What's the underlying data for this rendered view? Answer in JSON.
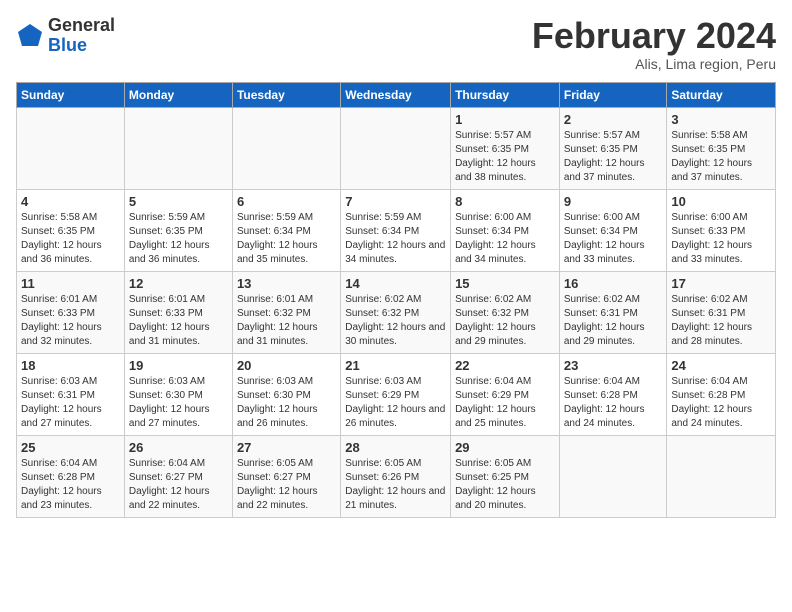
{
  "header": {
    "logo_general": "General",
    "logo_blue": "Blue",
    "title": "February 2024",
    "subtitle": "Alis, Lima region, Peru"
  },
  "columns": [
    "Sunday",
    "Monday",
    "Tuesday",
    "Wednesday",
    "Thursday",
    "Friday",
    "Saturday"
  ],
  "weeks": [
    [
      {
        "day": "",
        "detail": ""
      },
      {
        "day": "",
        "detail": ""
      },
      {
        "day": "",
        "detail": ""
      },
      {
        "day": "",
        "detail": ""
      },
      {
        "day": "1",
        "detail": "Sunrise: 5:57 AM\nSunset: 6:35 PM\nDaylight: 12 hours\nand 38 minutes."
      },
      {
        "day": "2",
        "detail": "Sunrise: 5:57 AM\nSunset: 6:35 PM\nDaylight: 12 hours\nand 37 minutes."
      },
      {
        "day": "3",
        "detail": "Sunrise: 5:58 AM\nSunset: 6:35 PM\nDaylight: 12 hours\nand 37 minutes."
      }
    ],
    [
      {
        "day": "4",
        "detail": "Sunrise: 5:58 AM\nSunset: 6:35 PM\nDaylight: 12 hours\nand 36 minutes."
      },
      {
        "day": "5",
        "detail": "Sunrise: 5:59 AM\nSunset: 6:35 PM\nDaylight: 12 hours\nand 36 minutes."
      },
      {
        "day": "6",
        "detail": "Sunrise: 5:59 AM\nSunset: 6:34 PM\nDaylight: 12 hours\nand 35 minutes."
      },
      {
        "day": "7",
        "detail": "Sunrise: 5:59 AM\nSunset: 6:34 PM\nDaylight: 12 hours\nand 34 minutes."
      },
      {
        "day": "8",
        "detail": "Sunrise: 6:00 AM\nSunset: 6:34 PM\nDaylight: 12 hours\nand 34 minutes."
      },
      {
        "day": "9",
        "detail": "Sunrise: 6:00 AM\nSunset: 6:34 PM\nDaylight: 12 hours\nand 33 minutes."
      },
      {
        "day": "10",
        "detail": "Sunrise: 6:00 AM\nSunset: 6:33 PM\nDaylight: 12 hours\nand 33 minutes."
      }
    ],
    [
      {
        "day": "11",
        "detail": "Sunrise: 6:01 AM\nSunset: 6:33 PM\nDaylight: 12 hours\nand 32 minutes."
      },
      {
        "day": "12",
        "detail": "Sunrise: 6:01 AM\nSunset: 6:33 PM\nDaylight: 12 hours\nand 31 minutes."
      },
      {
        "day": "13",
        "detail": "Sunrise: 6:01 AM\nSunset: 6:32 PM\nDaylight: 12 hours\nand 31 minutes."
      },
      {
        "day": "14",
        "detail": "Sunrise: 6:02 AM\nSunset: 6:32 PM\nDaylight: 12 hours\nand 30 minutes."
      },
      {
        "day": "15",
        "detail": "Sunrise: 6:02 AM\nSunset: 6:32 PM\nDaylight: 12 hours\nand 29 minutes."
      },
      {
        "day": "16",
        "detail": "Sunrise: 6:02 AM\nSunset: 6:31 PM\nDaylight: 12 hours\nand 29 minutes."
      },
      {
        "day": "17",
        "detail": "Sunrise: 6:02 AM\nSunset: 6:31 PM\nDaylight: 12 hours\nand 28 minutes."
      }
    ],
    [
      {
        "day": "18",
        "detail": "Sunrise: 6:03 AM\nSunset: 6:31 PM\nDaylight: 12 hours\nand 27 minutes."
      },
      {
        "day": "19",
        "detail": "Sunrise: 6:03 AM\nSunset: 6:30 PM\nDaylight: 12 hours\nand 27 minutes."
      },
      {
        "day": "20",
        "detail": "Sunrise: 6:03 AM\nSunset: 6:30 PM\nDaylight: 12 hours\nand 26 minutes."
      },
      {
        "day": "21",
        "detail": "Sunrise: 6:03 AM\nSunset: 6:29 PM\nDaylight: 12 hours\nand 26 minutes."
      },
      {
        "day": "22",
        "detail": "Sunrise: 6:04 AM\nSunset: 6:29 PM\nDaylight: 12 hours\nand 25 minutes."
      },
      {
        "day": "23",
        "detail": "Sunrise: 6:04 AM\nSunset: 6:28 PM\nDaylight: 12 hours\nand 24 minutes."
      },
      {
        "day": "24",
        "detail": "Sunrise: 6:04 AM\nSunset: 6:28 PM\nDaylight: 12 hours\nand 24 minutes."
      }
    ],
    [
      {
        "day": "25",
        "detail": "Sunrise: 6:04 AM\nSunset: 6:28 PM\nDaylight: 12 hours\nand 23 minutes."
      },
      {
        "day": "26",
        "detail": "Sunrise: 6:04 AM\nSunset: 6:27 PM\nDaylight: 12 hours\nand 22 minutes."
      },
      {
        "day": "27",
        "detail": "Sunrise: 6:05 AM\nSunset: 6:27 PM\nDaylight: 12 hours\nand 22 minutes."
      },
      {
        "day": "28",
        "detail": "Sunrise: 6:05 AM\nSunset: 6:26 PM\nDaylight: 12 hours\nand 21 minutes."
      },
      {
        "day": "29",
        "detail": "Sunrise: 6:05 AM\nSunset: 6:25 PM\nDaylight: 12 hours\nand 20 minutes."
      },
      {
        "day": "",
        "detail": ""
      },
      {
        "day": "",
        "detail": ""
      }
    ]
  ]
}
